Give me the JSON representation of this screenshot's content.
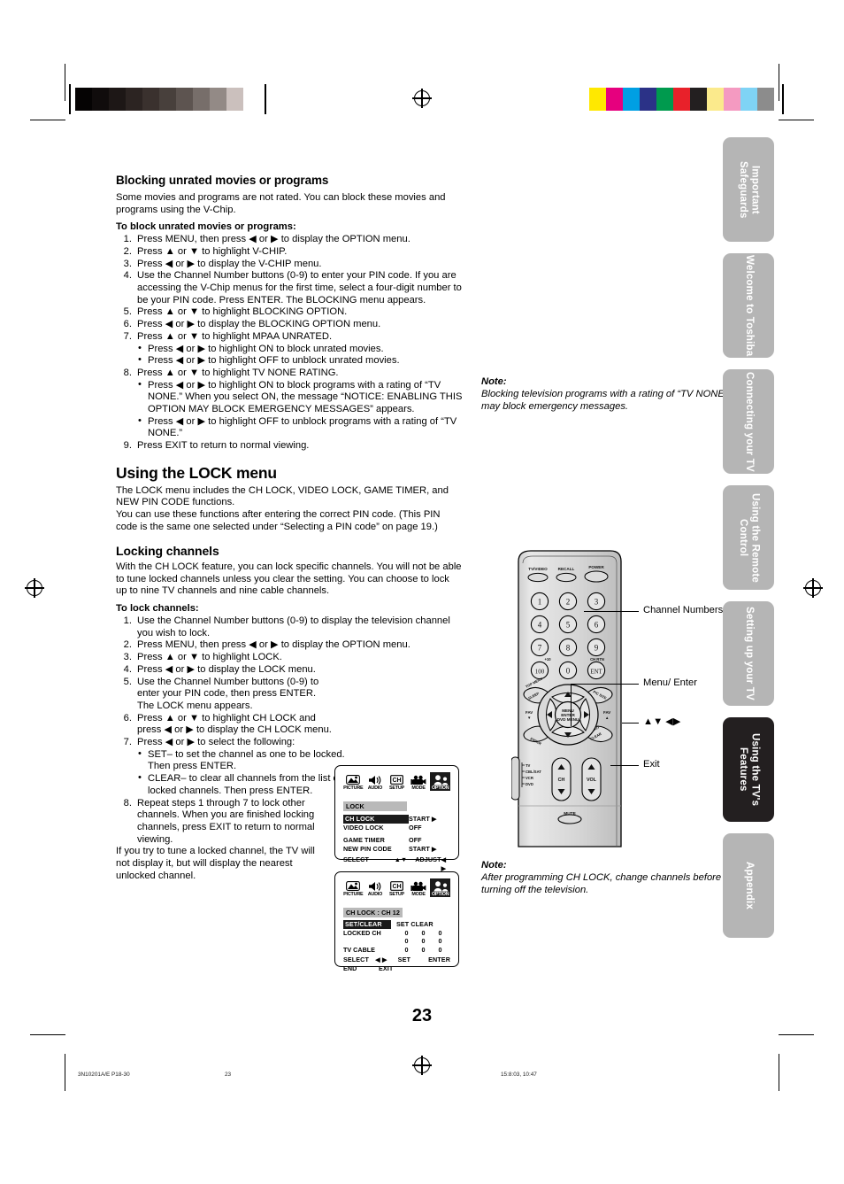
{
  "page_number": "23",
  "sections": {
    "blocking": {
      "heading": "Blocking unrated movies or programs",
      "intro": "Some movies and programs are not rated. You can block these movies and programs using the V-Chip.",
      "lead": "To block unrated movies or programs:",
      "steps": [
        "Press MENU, then press ◀ or ▶ to display the OPTION menu.",
        "Press ▲ or ▼ to highlight V-CHIP.",
        "Press ◀ or ▶ to display the V-CHIP menu.",
        "Use the Channel Number buttons (0-9) to enter your PIN code. If you are accessing the V-Chip menus for the first time, select a four-digit number to be your PIN code. Press ENTER. The BLOCKING menu appears.",
        "Press ▲ or ▼ to highlight BLOCKING OPTION.",
        "Press ◀ or ▶ to display the BLOCKING OPTION menu.",
        "Press ▲ or ▼ to highlight MPAA UNRATED.",
        "Press ▲ or ▼ to highlight TV NONE RATING.",
        "Press EXIT to return to normal viewing."
      ],
      "bullets_7": [
        "Press ◀ or ▶ to highlight ON to block unrated movies.",
        "Press ◀ or ▶ to highlight OFF to unblock unrated movies."
      ],
      "bullets_8": [
        "Press ◀ or ▶ to highlight ON to block programs with a rating of “TV NONE.” When you select ON, the message “NOTICE: ENABLING THIS OPTION MAY BLOCK EMERGENCY MESSAGES” appears.",
        "Press ◀ or ▶ to highlight OFF to unblock programs with a rating of “TV NONE.”"
      ]
    },
    "lock_menu": {
      "heading": "Using the LOCK menu",
      "para1": "The LOCK menu includes the CH LOCK, VIDEO LOCK, GAME TIMER, and NEW PIN CODE functions.",
      "para2": "You can use these functions after entering the correct PIN code. (This PIN code is the same one selected under “Selecting a PIN code” on page 19.)"
    },
    "locking_channels": {
      "heading": "Locking channels",
      "intro": "With the CH LOCK feature, you can lock specific channels. You will not be able to tune locked channels unless you clear the setting. You can choose to lock up to nine TV channels and nine cable channels.",
      "lead": "To lock channels:",
      "steps": [
        "Use the Channel Number buttons (0-9) to display the television channel you wish to lock.",
        "Press MENU, then press ◀ or ▶ to display the OPTION menu.",
        "Press ▲ or ▼ to highlight LOCK.",
        "Press ◀ or ▶ to display the LOCK menu.",
        "Use the Channel Number buttons (0-9) to enter your PIN code, then press ENTER. The LOCK menu appears.",
        "Press ▲ or ▼ to highlight CH LOCK and press ◀ or ▶ to display the CH LOCK menu.",
        "Press ◀ or ▶ to select the following:",
        "Repeat steps 1 through 7 to lock other channels. When you are finished locking channels, press EXIT to return to normal viewing."
      ],
      "bullets_7": [
        "SET– to set the channel as one to be locked. Then press ENTER.",
        "CLEAR– to clear all channels from the list of locked channels. Then press ENTER."
      ],
      "closing": "If you try to tune a locked channel, the TV will not display it, but will display the nearest unlocked channel."
    }
  },
  "notes": {
    "note1": {
      "label": "Note:",
      "text": "Blocking television programs with a rating of “TV NONE” may block emergency messages."
    },
    "note2": {
      "label": "Note:",
      "text": "After programming CH LOCK, change channels before turning off the television."
    }
  },
  "osd_icons": [
    {
      "cap": "PICTURE",
      "name": "picture-icon"
    },
    {
      "cap": "AUDIO",
      "name": "audio-icon"
    },
    {
      "cap": "SETUP",
      "name": "setup-icon"
    },
    {
      "cap": "MODE",
      "name": "mode-icon"
    },
    {
      "cap": "OPTION",
      "name": "option-icon"
    }
  ],
  "osd_lock": {
    "title": "LOCK",
    "rows": [
      {
        "label": "CH LOCK",
        "value": "START ▶",
        "highlight": true
      },
      {
        "label": "VIDEO LOCK",
        "value": "OFF",
        "highlight": false
      },
      {
        "label": "GAME TIMER",
        "value": "OFF",
        "highlight": false
      },
      {
        "label": "NEW PIN CODE",
        "value": "START ▶",
        "highlight": false
      }
    ],
    "footer_left_label": "SELECT",
    "footer_left_value": "▲▼",
    "footer_right_label": "ADJUST",
    "footer_right_value": "◀ ▶"
  },
  "osd_chlock": {
    "title": "CH LOCK : CH 12",
    "setclear_highlight": "SET/CLEAR",
    "setclear_options": "SET CLEAR",
    "locked_ch_label": "LOCKED CH",
    "tv_cable_label": "TV CABLE",
    "grid": [
      [
        "0",
        "0",
        "0"
      ],
      [
        "0",
        "0",
        "0"
      ],
      [
        "0",
        "0",
        "0"
      ]
    ],
    "footer": [
      {
        "l": "SELECT",
        "m": "◀ ▶",
        "r1": "SET",
        "r2": "ENTER"
      },
      {
        "l": "END",
        "m": "EXIT",
        "r1": "",
        "r2": ""
      }
    ]
  },
  "remote": {
    "top_buttons": [
      "TV/VIDEO",
      "RECALL",
      "POWER"
    ],
    "keys": [
      "1",
      "2",
      "3",
      "4",
      "5",
      "6",
      "7",
      "8",
      "9",
      "100",
      "0",
      "ENT"
    ],
    "key_sup_100": "+10",
    "key_sup_ent": "CH RTN",
    "center_label": "MENU ENTER DVD MENU",
    "side_labels": [
      "TOP MENU / SLEEP",
      "PIC SIZE",
      "ENTER",
      "EXIT / CLEAR"
    ],
    "fav_left": "FAV ▼",
    "fav_right": "FAV ▲",
    "mode_switch": [
      "TV",
      "CBL/SAT",
      "VCR",
      "DVD"
    ],
    "ch_label": "CH",
    "vol_label": "VOL",
    "mute_label": "MUTE",
    "callouts": [
      {
        "text": "Channel Numbers",
        "name": "callout-channel-numbers"
      },
      {
        "text": "Menu/ Enter",
        "name": "callout-menu-enter"
      },
      {
        "text": "▲▼ ◀▶",
        "name": "callout-arrows"
      },
      {
        "text": "Exit",
        "name": "callout-exit"
      }
    ]
  },
  "rail_tabs": [
    {
      "label": "Important Safeguards",
      "active": false
    },
    {
      "label": "Welcome to Toshiba",
      "active": false
    },
    {
      "label": "Connecting your TV",
      "active": false
    },
    {
      "label": "Using the Remote Control",
      "active": false
    },
    {
      "label": "Setting up your TV",
      "active": false
    },
    {
      "label": "Using the TV's Features",
      "active": true
    },
    {
      "label": "Appendix",
      "active": false
    }
  ],
  "footer": {
    "left": "3N10201A/E P18-30",
    "center": "23",
    "right": "15:8:03, 10:47"
  },
  "colorbars": {
    "gray_ramp": [
      "#050303",
      "#100c0c",
      "#1d1716",
      "#2c2422",
      "#3a312e",
      "#48403c",
      "#5d5450",
      "#776e6a",
      "#938a86",
      "#cbc0bd",
      "#ffffff"
    ],
    "chroma": [
      "#ffe800",
      "#e6007e",
      "#009fe3",
      "#2b3287",
      "#009a4e",
      "#e8212a",
      "#231f20",
      "#fbea8c",
      "#f49ac1",
      "#7fd3f5",
      "#8c8c8c"
    ]
  }
}
